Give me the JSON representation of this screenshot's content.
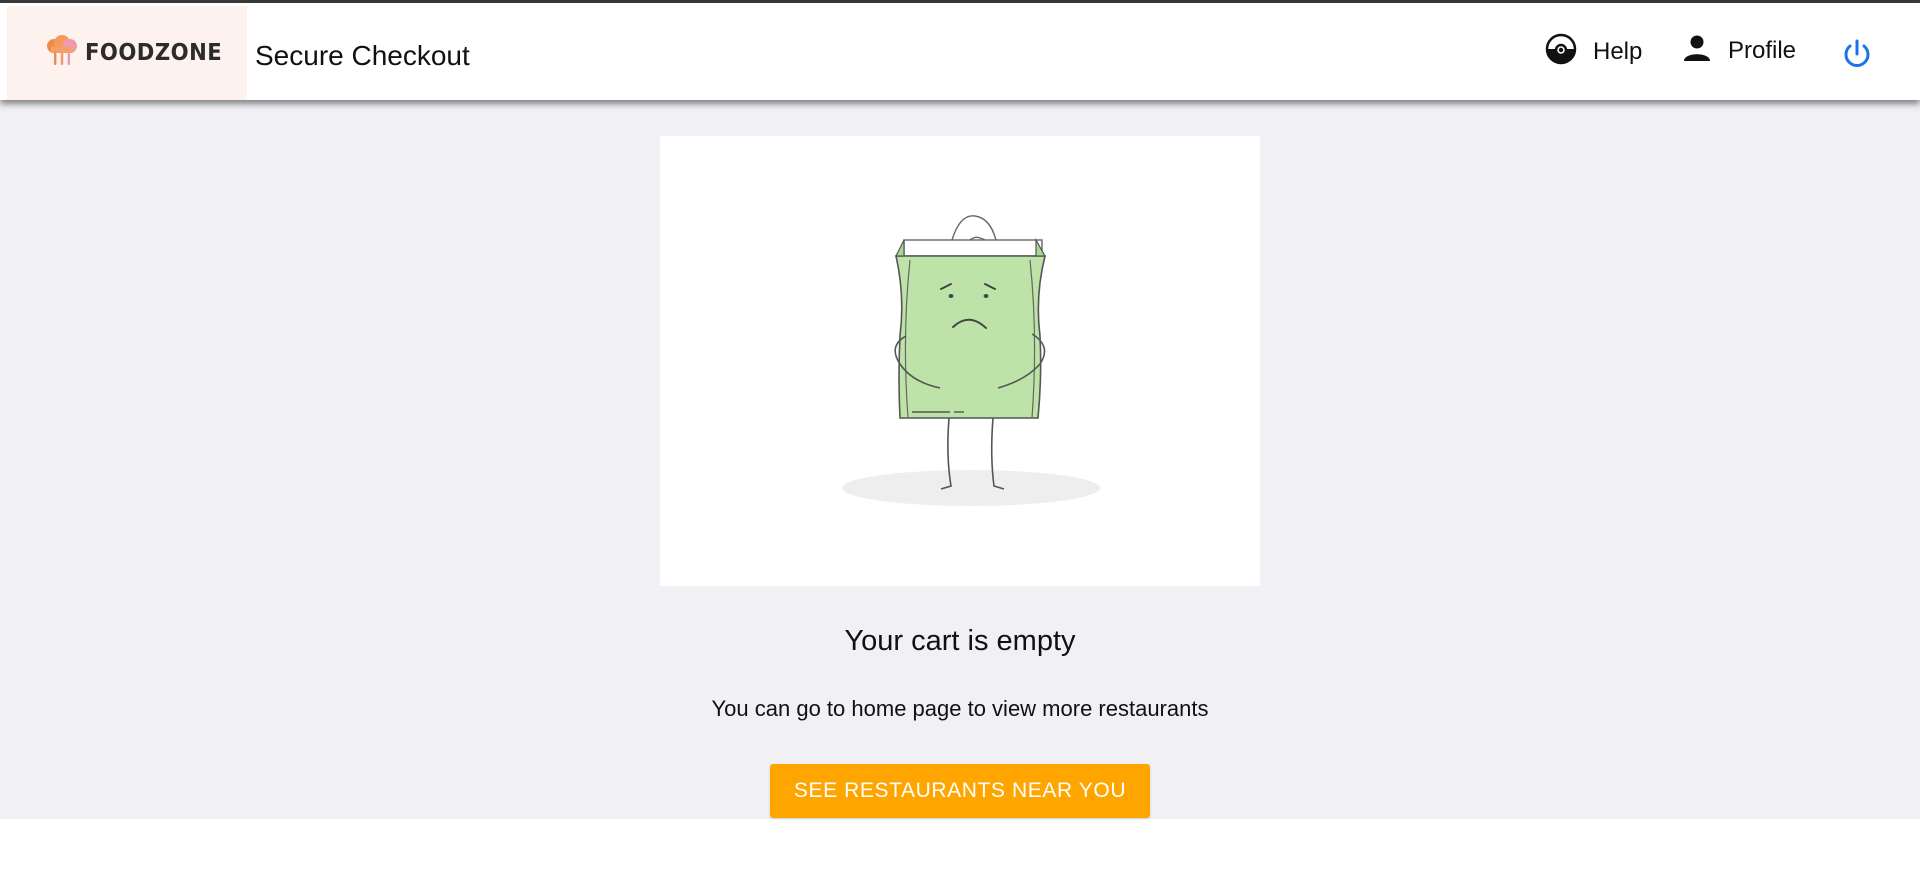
{
  "header": {
    "brand": "FOODZONE",
    "title": "Secure Checkout",
    "nav": {
      "help_label": "Help",
      "profile_label": "Profile"
    },
    "icons": [
      "chef-hat-logo-icon",
      "help-icon",
      "person-icon",
      "power-icon"
    ]
  },
  "empty_cart": {
    "title": "Your cart is empty",
    "subtitle": "You can go to home page to view more restaurants",
    "cta_label": "SEE RESTAURANTS NEAR YOU",
    "illustration": "sad-shopping-bag-illustration"
  },
  "colors": {
    "accent": "#ffa500",
    "power_icon": "#1a73e8",
    "bag": "#bde3a8",
    "page_bg": "#f1f0f5",
    "logo_bg": "#fdf2ee"
  }
}
